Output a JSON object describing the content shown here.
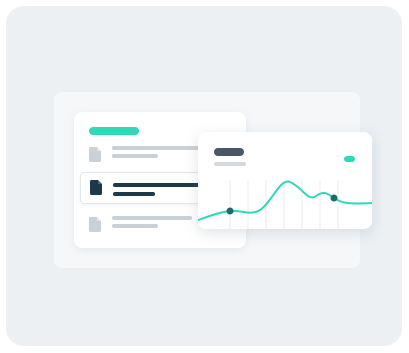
{
  "colors": {
    "background": "#ecf0f3",
    "panel": "#f5f7f9",
    "accent": "#2ed8b8",
    "dark_navy": "#1d3a48",
    "slate": "#4a5668",
    "placeholder_gray": "#c9d1d8",
    "grid_line": "#e7ebef"
  },
  "list_card": {
    "rows": [
      {
        "icon": "document-icon",
        "state": "default"
      },
      {
        "icon": "document-icon",
        "state": "selected"
      },
      {
        "icon": "document-icon",
        "state": "default"
      }
    ]
  },
  "chart_card": {
    "icon_badge": "accent-badge",
    "line_color": "#2ed8b8"
  }
}
